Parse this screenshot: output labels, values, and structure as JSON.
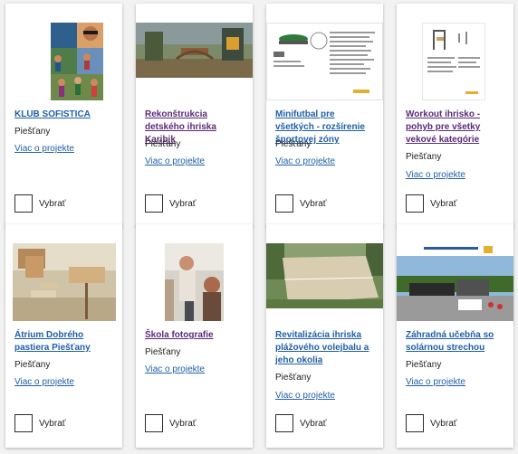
{
  "cards": [
    {
      "title": "KLUB SOFISTICA",
      "city": "Piešťany",
      "more": "Viac o projekte",
      "choose": "Vybrať"
    },
    {
      "title": "Rekonštrukcia detského ihriska Karibik",
      "city": "Piešťany",
      "more": "Viac o projekte",
      "choose": "Vybrať"
    },
    {
      "title": "Minifutbal pre všetkých - rozšírenie športovej zóny",
      "city": "Piešťany",
      "more": "Viac o projekte",
      "choose": "Vybrať"
    },
    {
      "title": "Workout ihrisko - pohyb pre všetky vekové kategórie",
      "city": "Piešťany",
      "more": "Viac o projekte",
      "choose": "Vybrať"
    },
    {
      "title": "Átrium Dobrého pastiera Piešťany",
      "city": "Piešťany",
      "more": "Viac o projekte",
      "choose": "Vybrať"
    },
    {
      "title": "Škola fotografie",
      "city": "Piešťany",
      "more": "Viac o projekte",
      "choose": "Vybrať"
    },
    {
      "title": "Revitalizácia ihriska plážového volejbalu a jeho okolia",
      "city": "Piešťany",
      "more": "Viac o projekte",
      "choose": "Vybrať"
    },
    {
      "title": "Záhradná učebňa so solárnou strechou",
      "city": "Piešťany",
      "more": "Viac o projekte",
      "choose": "Vybrať"
    }
  ],
  "colors": {
    "link": "#1f5fa8",
    "visited": "#5a2a7a"
  }
}
